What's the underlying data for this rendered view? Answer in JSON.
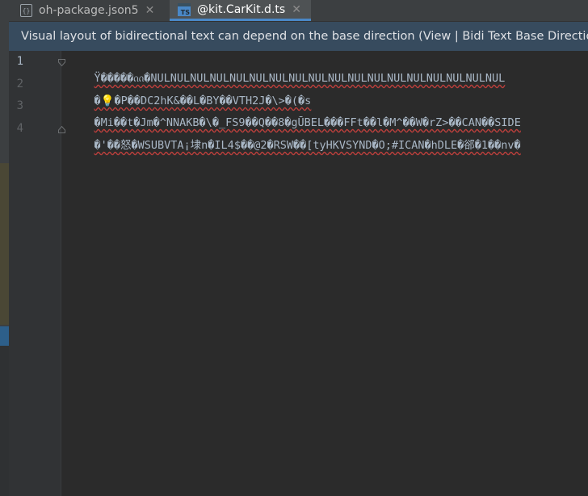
{
  "tabs": [
    {
      "label": "oh-package.json5",
      "icon": "json-file-icon",
      "active": false
    },
    {
      "label": "@kit.CarKit.d.ts",
      "icon": "typescript-file-icon",
      "active": true
    }
  ],
  "banner": {
    "text": "Visual layout of bidirectional text can depend on the base direction (View | Bidi Text Base Directio"
  },
  "editor": {
    "line_numbers": [
      "1",
      "2",
      "3",
      "4"
    ],
    "lines": [
      "Ÿ�����ᦶ�NULNULNULNULNULNULNULNULNULNULNULNULNULNULNULNULNULNUL",
      "�💡�P��DC2hK&��L�BY��VTH2J�\\>�(�s",
      "�Mi��t�Jm�^NNAKB�\\�_FS9��Q��8�gŪBEL���FFt��l�M^��W�rZ>��CAN��SIDE",
      "�'��怒�WSUBVTA¡埭n�IL4$��@2�RSW��[tyHKVSYND�O;#ICAN�hDLE�郤�1��nv�"
    ]
  },
  "colors": {
    "editor_bg": "#2b2b2b",
    "gutter_bg": "#313335",
    "banner_bg": "#374b5e",
    "tab_active_underline": "#4a88c7",
    "error_underline": "#bc3f3c"
  }
}
